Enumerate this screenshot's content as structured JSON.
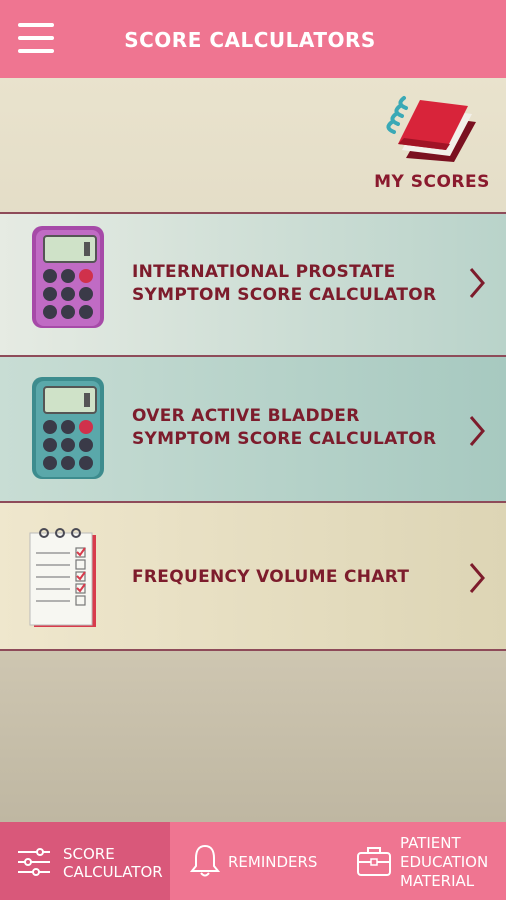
{
  "header": {
    "title": "SCORE CALCULATORS",
    "menu_icon": "hamburger-menu-icon"
  },
  "my_scores": {
    "label": "MY SCORES",
    "icon": "notebook-icon"
  },
  "rows": [
    {
      "line1": "INTERNATIONAL PROSTATE",
      "line2": "SYMPTOM SCORE CALCULATOR",
      "icon": "calculator-icon",
      "accent": "#a64aa8"
    },
    {
      "line1": "OVER ACTIVE BLADDER",
      "line2": "SYMPTOM SCORE CALCULATOR",
      "icon": "calculator-icon",
      "accent": "#3d8c8e"
    },
    {
      "line1": "FREQUENCY VOLUME CHART",
      "line2": "",
      "icon": "checklist-icon",
      "accent": "#d83b4c"
    }
  ],
  "tabs": [
    {
      "label_line1": "SCORE",
      "label_line2": "CALCULATOR",
      "icon": "sliders-icon",
      "active": true
    },
    {
      "label_line1": "REMINDERS",
      "label_line2": "",
      "icon": "bell-icon",
      "active": false
    },
    {
      "label_line1": "PATIENT",
      "label_line2": "EDUCATION",
      "label_line3": "MATERIAL",
      "icon": "briefcase-icon",
      "active": false
    }
  ],
  "colors": {
    "primary": "#ef7591",
    "active_tab": "#d9587a",
    "text_dark": "#7d1c2c"
  }
}
